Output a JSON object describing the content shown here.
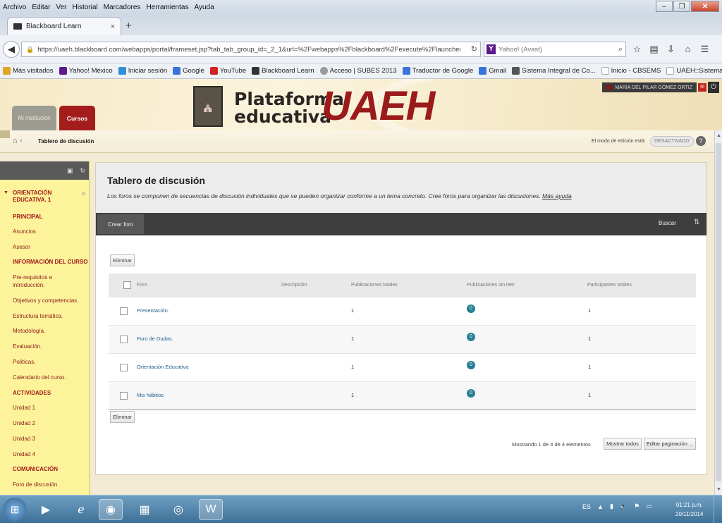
{
  "browser": {
    "menu": [
      "Archivo",
      "Editar",
      "Ver",
      "Historial",
      "Marcadores",
      "Herramientas",
      "Ayuda"
    ],
    "tab_title": "Blackboard Learn",
    "tab_close": "×",
    "new_tab": "+",
    "url": "https://uaeh.blackboard.com/webapps/portal/frameset.jsp?tab_tab_group_id=_2_1&url=%2Fwebapps%2Fblackboard%2Fexecute%2Flauncher%3Ftype%",
    "search_placeholder": "Yahoo! (Avast)",
    "bookmarks": [
      {
        "label": "Más visitados",
        "color": "#e0a526"
      },
      {
        "label": "Yahoo! México",
        "color": "#5a1a8c"
      },
      {
        "label": "Iniciar sesión",
        "color": "#2f8fd8"
      },
      {
        "label": "Google",
        "color": "#3b73d8"
      },
      {
        "label": "YouTube",
        "color": "#d32020"
      },
      {
        "label": "Blackboard Learn",
        "color": "#333333"
      },
      {
        "label": "Acceso | SUBES 2013",
        "color": "#9a9a9a"
      },
      {
        "label": "Traductor de Google",
        "color": "#3b73d8"
      },
      {
        "label": "Gmail",
        "color": "#3b73d8"
      },
      {
        "label": "Sistema Integral de Co...",
        "color": "#555555"
      },
      {
        "label": "Inicio - CBSEMS",
        "color": "#cccccc"
      },
      {
        "label": "UAEH::Sistema Institu...",
        "color": "#cccccc"
      }
    ]
  },
  "header": {
    "brand_line1": "Plataforma",
    "brand_line2": "educativa",
    "brand_name": "UAEH",
    "user_name": "MARÍA DEL PILAR GÓMEZ ORTIZ",
    "tab_institution": "Mi institución",
    "tab_courses": "Cursos"
  },
  "breadcrumb": {
    "current": "Tablero de discusión",
    "edit_mode_label": "El modo de edición está:",
    "edit_mode_value": "DESACTIVADO"
  },
  "course_menu": {
    "title": "ORIENTACIÓN EDUCATIVA. 1",
    "items": [
      {
        "label": "PRINCIPAL",
        "header": true
      },
      {
        "label": "Anuncios",
        "header": false
      },
      {
        "label": "Asesor",
        "header": false
      },
      {
        "label": "INFORMACIÓN DEL CURSO",
        "header": true
      },
      {
        "label": "Pre-requisitos e",
        "header": false
      },
      {
        "label": "introducción.",
        "header": false
      },
      {
        "label": "Objetivos y competencias.",
        "header": false
      },
      {
        "label": "Estructura temática.",
        "header": false
      },
      {
        "label": "Metodología.",
        "header": false
      },
      {
        "label": "Evaluación.",
        "header": false
      },
      {
        "label": "Políticas.",
        "header": false
      },
      {
        "label": "Calendario del curso.",
        "header": false
      },
      {
        "label": "ACTIVIDADES",
        "header": true
      },
      {
        "label": "Unidad 1",
        "header": false
      },
      {
        "label": "Unidad 2",
        "header": false
      },
      {
        "label": "Unidad 3",
        "header": false
      },
      {
        "label": "Unidad 4",
        "header": false
      },
      {
        "label": "COMUNICACIÓN",
        "header": true
      },
      {
        "label": "Foro de discusión",
        "header": false
      }
    ]
  },
  "main": {
    "title": "Tablero de discusión",
    "description": "Los foros se componen de secuencias de discusión individuales que se pueden organizar conforme a un tema concreto. Cree foros para organizar las discusiones.",
    "more_help": "Más ayuda",
    "create_forum": "Crear foro",
    "search": "Buscar",
    "delete": "Eliminar",
    "columns": [
      "Foro",
      "Descripción",
      "Publicaciones totales",
      "Publicaciones sin leer",
      "Participantes totales"
    ],
    "rows": [
      {
        "forum": "Presentación.",
        "total": "1",
        "unread": "0",
        "participants": "1"
      },
      {
        "forum": "Foro de Dudas.",
        "total": "1",
        "unread": "0",
        "participants": "1"
      },
      {
        "forum": "Orientación Educativa",
        "total": "1",
        "unread": "0",
        "participants": "1"
      },
      {
        "forum": "Mis hábitos",
        "total": "1",
        "unread": "0",
        "participants": "1"
      }
    ],
    "showing": "Mostrando 1 de 4 de 4 elementos",
    "show_all": "Mostrar todos",
    "edit_paging": "Editar paginación ..."
  },
  "taskbar": {
    "lang": "ES",
    "time": "01:21 p.m.",
    "date": "20/11/2014"
  }
}
